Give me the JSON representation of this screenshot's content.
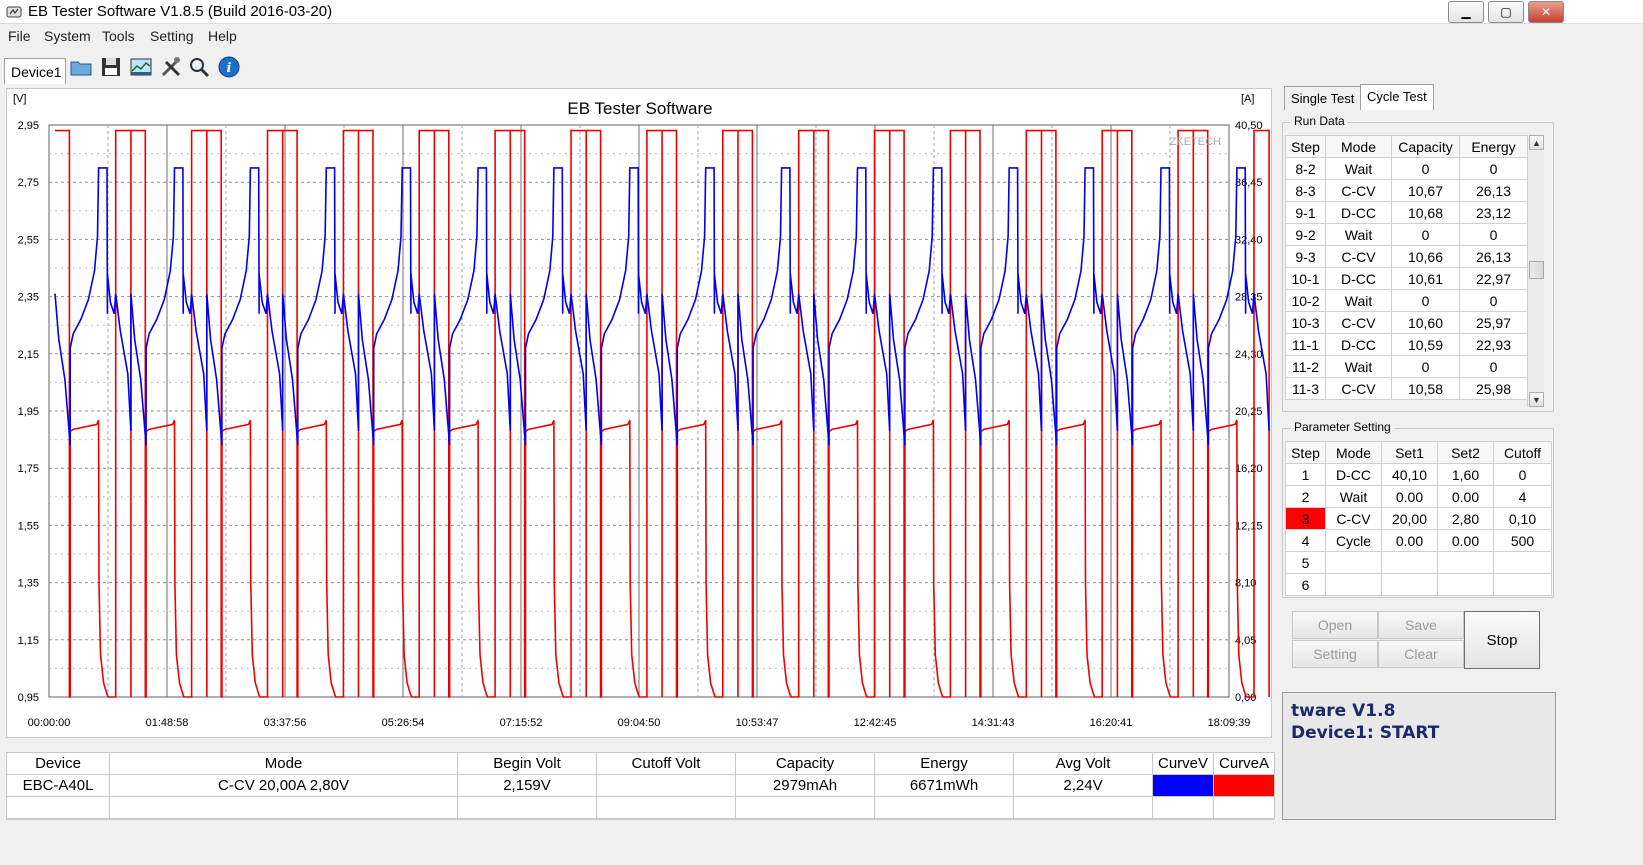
{
  "window": {
    "title": "EB Tester Software V1.8.5 (Build 2016-03-20)",
    "minimize": "▁",
    "maximize": "▢",
    "close": "✕"
  },
  "menu": [
    "File",
    "System",
    "Tools",
    "Setting",
    "Help"
  ],
  "toolbar": {
    "device_tab": "Device1",
    "buttons": [
      "folder-icon",
      "save-icon",
      "chart-icon",
      "tools-icon",
      "magnifier-icon",
      "info-icon"
    ]
  },
  "chart": {
    "title": "EB Tester Software",
    "watermark": "ZKETECH",
    "left_unit": "[V]",
    "right_unit": "[A]",
    "left_ticks": [
      "2,95",
      "2,75",
      "2,55",
      "2,35",
      "2,15",
      "1,95",
      "1,75",
      "1,55",
      "1,35",
      "1,15",
      "0,95"
    ],
    "right_ticks": [
      "40,50",
      "36,45",
      "32,40",
      "28,35",
      "24,30",
      "20,25",
      "16,20",
      "12,15",
      "8,10",
      "4,05",
      "0,00"
    ],
    "x_ticks": [
      "00:00:00",
      "01:48:58",
      "03:37:56",
      "05:26:54",
      "07:15:52",
      "09:04:50",
      "10:53:47",
      "12:42:45",
      "14:31:43",
      "16:20:41",
      "18:09:39"
    ]
  },
  "chart_data": {
    "type": "line",
    "title": "EB Tester Software",
    "y_left": {
      "unit": "[V]",
      "range": [
        0.95,
        2.95
      ]
    },
    "y_right": {
      "unit": "[A]",
      "range": [
        0.0,
        40.5
      ]
    },
    "x_range_hours": [
      0,
      18.16
    ],
    "cycles": 16,
    "cycle_shape": {
      "voltage_v": {
        "discharge_start": 2.36,
        "discharge_end": 1.83,
        "charge_start": 2.17,
        "charge_cv_plateau": 2.8,
        "rest_level": 2.33
      },
      "current_a": {
        "discharge": 40.1,
        "charge_start": 18.8,
        "charge_end": 19.3,
        "taper_to": 0.0
      }
    },
    "grid": true,
    "series": [
      {
        "name": "CurveV",
        "color": "#0000ee"
      },
      {
        "name": "CurveA",
        "color": "#ee0000"
      }
    ]
  },
  "tabs": [
    "Single Test",
    "Cycle Test"
  ],
  "run_data": {
    "title": "Run Data",
    "columns": [
      "Step",
      "Mode",
      "Capacity",
      "Energy"
    ],
    "rows": [
      [
        "8-2",
        "Wait",
        "0",
        "0"
      ],
      [
        "8-3",
        "C-CV",
        "10,67",
        "26,13"
      ],
      [
        "9-1",
        "D-CC",
        "10,68",
        "23,12"
      ],
      [
        "9-2",
        "Wait",
        "0",
        "0"
      ],
      [
        "9-3",
        "C-CV",
        "10,66",
        "26,13"
      ],
      [
        "10-1",
        "D-CC",
        "10,61",
        "22,97"
      ],
      [
        "10-2",
        "Wait",
        "0",
        "0"
      ],
      [
        "10-3",
        "C-CV",
        "10,60",
        "25,97"
      ],
      [
        "11-1",
        "D-CC",
        "10,59",
        "22,93"
      ],
      [
        "11-2",
        "Wait",
        "0",
        "0"
      ],
      [
        "11-3",
        "C-CV",
        "10,58",
        "25,98"
      ]
    ]
  },
  "parameter_setting": {
    "title": "Parameter Setting",
    "columns": [
      "Step",
      "Mode",
      "Set1",
      "Set2",
      "Cutoff"
    ],
    "rows": [
      [
        "1",
        "D-CC",
        "40,10",
        "1,60",
        "0"
      ],
      [
        "2",
        "Wait",
        "0.00",
        "0.00",
        "4"
      ],
      [
        "3",
        "C-CV",
        "20,00",
        "2,80",
        "0,10"
      ],
      [
        "4",
        "Cycle",
        "0.00",
        "0.00",
        "500"
      ],
      [
        "5",
        "",
        "",
        "",
        ""
      ],
      [
        "6",
        "",
        "",
        "",
        ""
      ]
    ],
    "active_step_color": "#ff0000"
  },
  "buttons": {
    "open": "Open",
    "save": "Save",
    "setting": "Setting",
    "clear": "Clear",
    "stop": "Stop"
  },
  "status": {
    "line1": "tware V1.8",
    "line2": "Device1: START"
  },
  "summary": {
    "columns": [
      "Device",
      "Mode",
      "Begin Volt",
      "Cutoff Volt",
      "Capacity",
      "Energy",
      "Avg Volt",
      "CurveV",
      "CurveA"
    ],
    "row": [
      "EBC-A40L",
      "C-CV  20,00A  2,80V",
      "2,159V",
      "",
      "2979mAh",
      "6671mWh",
      "2,24V",
      "",
      ""
    ],
    "curve_v_color": "#0000ff",
    "curve_a_color": "#ff0000"
  }
}
